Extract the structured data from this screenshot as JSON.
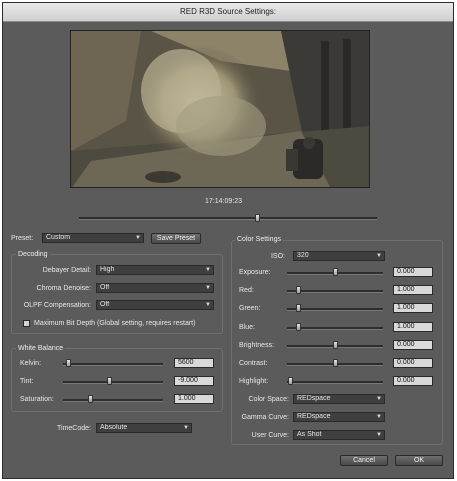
{
  "window": {
    "title": "RED R3D Source Settings:"
  },
  "preview": {
    "timecode": "17:14:09:23",
    "scrub_position": 0.6
  },
  "preset": {
    "label": "Preset:",
    "value": "Custom",
    "save_label": "Save Preset"
  },
  "decoding": {
    "title": "Decoding",
    "debayer": {
      "label": "Debayer Detail:",
      "value": "High"
    },
    "chroma": {
      "label": "Chroma Denoise:",
      "value": "Off"
    },
    "olpf": {
      "label": "OLPF Compensation:",
      "value": "Off"
    },
    "max_bit_depth": {
      "label": "Maximum Bit Depth (Global setting, requires restart)",
      "checked": false
    }
  },
  "white_balance": {
    "title": "White Balance",
    "kelvin": {
      "label": "Kelvin:",
      "value": "5600",
      "position": 0.03
    },
    "tint": {
      "label": "Tint:",
      "value": "-9.000",
      "position": 0.46
    },
    "saturation": {
      "label": "Saturation:",
      "value": "1.000",
      "position": 0.26
    }
  },
  "timecode": {
    "label": "TimeCode:",
    "value": "Absolute"
  },
  "color": {
    "title": "Color Settings",
    "iso": {
      "label": "ISO:",
      "value": "320"
    },
    "sliders": [
      {
        "label": "Exposure:",
        "value": "0.000",
        "position": 0.5
      },
      {
        "label": "Red:",
        "value": "1.000",
        "position": 0.1
      },
      {
        "label": "Green:",
        "value": "1.000",
        "position": 0.1
      },
      {
        "label": "Blue:",
        "value": "1.000",
        "position": 0.1
      },
      {
        "label": "Brightness:",
        "value": "0.000",
        "position": 0.5
      },
      {
        "label": "Contrast:",
        "value": "0.000",
        "position": 0.5
      },
      {
        "label": "Highlight:",
        "value": "0.000",
        "position": 0.01
      }
    ],
    "color_space": {
      "label": "Color Space:",
      "value": "REDspace"
    },
    "gamma_curve": {
      "label": "Gamma Curve:",
      "value": "REDspace"
    },
    "user_curve": {
      "label": "User Curve:",
      "value": "As Shot"
    }
  },
  "buttons": {
    "cancel": "Cancel",
    "ok": "OK"
  }
}
